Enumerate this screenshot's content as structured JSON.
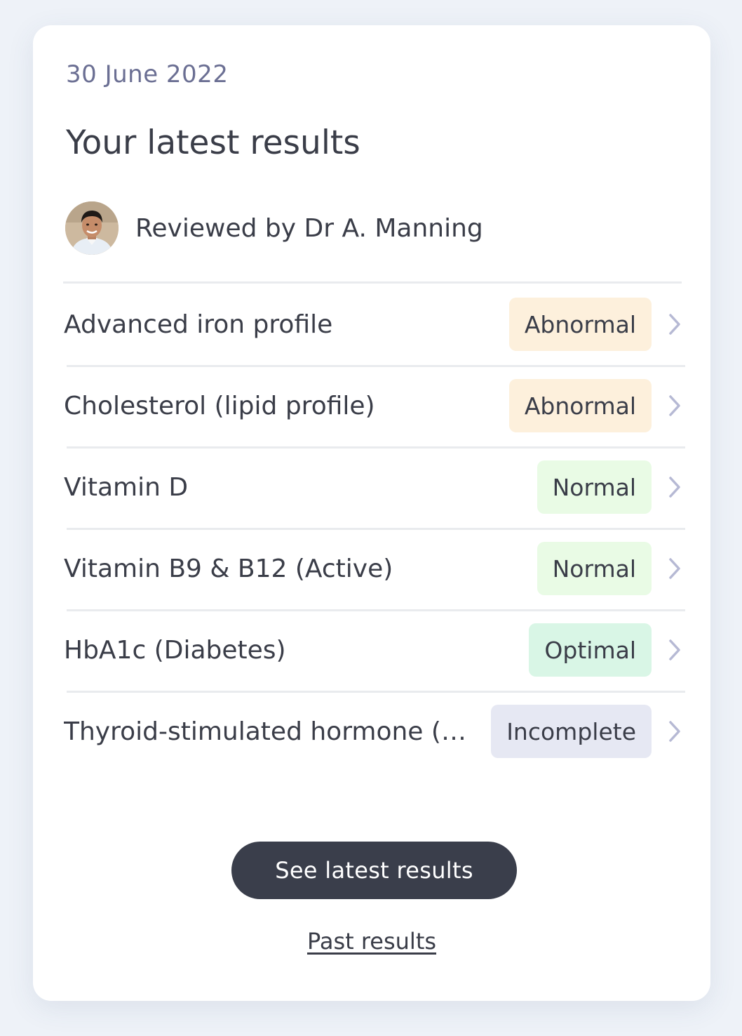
{
  "card": {
    "date": "30 June 2022",
    "title": "Your latest results",
    "reviewer": {
      "text": "Reviewed by Dr A. Manning",
      "avatar_icon": "doctor-avatar"
    }
  },
  "results": [
    {
      "name": "Advanced iron profile",
      "status": "Abnormal",
      "status_type": "abnormal"
    },
    {
      "name": "Cholesterol (lipid profile)",
      "status": "Abnormal",
      "status_type": "abnormal"
    },
    {
      "name": "Vitamin D",
      "status": "Normal",
      "status_type": "normal"
    },
    {
      "name": "Vitamin B9 & B12 (Active)",
      "status": "Normal",
      "status_type": "normal"
    },
    {
      "name": "HbA1c (Diabetes)",
      "status": "Optimal",
      "status_type": "optimal"
    },
    {
      "name": "Thyroid-stimulated hormone (TSH)",
      "status": "Incomplete",
      "status_type": "incomplete"
    }
  ],
  "status_colors": {
    "abnormal": "#fdf0dc",
    "normal": "#e9fbe5",
    "optimal": "#d9f6e6",
    "incomplete": "#e6e8f3"
  },
  "actions": {
    "primary_label": "See latest results",
    "secondary_label": "Past results"
  }
}
